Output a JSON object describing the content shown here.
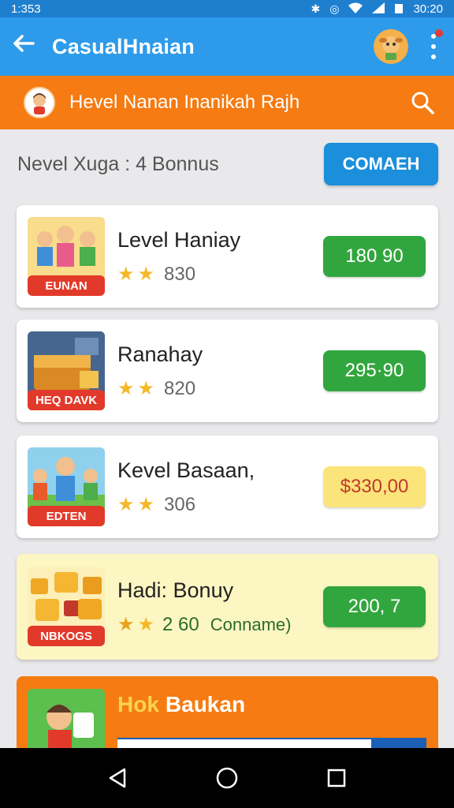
{
  "status_bar": {
    "time": "1:353",
    "clock": "30:20"
  },
  "app_bar": {
    "title": "CasualHnaian"
  },
  "sub_bar": {
    "title": "Hevel Nanan Inanikah Rajh"
  },
  "section": {
    "title": "Nevel Xuga : 4 Bonnus",
    "action_label": "COMAEH"
  },
  "cards": [
    {
      "title": "Level Haniay",
      "rating": "830",
      "price": "180 90",
      "thumb_label": "EUNAN",
      "stars": 2
    },
    {
      "title": "Ranahay",
      "rating": "820",
      "price": "295·90",
      "thumb_label": "HEQ DAVK",
      "stars": 2
    },
    {
      "title": "Kevel Basaan,",
      "rating": "306",
      "price": "$330,00",
      "thumb_label": "EDTEN",
      "stars": 2
    },
    {
      "title": "Hadi: Bonuy",
      "rating": "2 60",
      "rating_suffix": "Conname)",
      "price": "200, 7",
      "thumb_label": "NBKOGS",
      "stars": 2
    }
  ],
  "bottom_card": {
    "logo": "Hok",
    "title": "Baukan"
  },
  "colors": {
    "primary": "#2d9bea",
    "accent": "#f57b12",
    "green": "#32a63e",
    "highlight": "#fcf6c2"
  }
}
